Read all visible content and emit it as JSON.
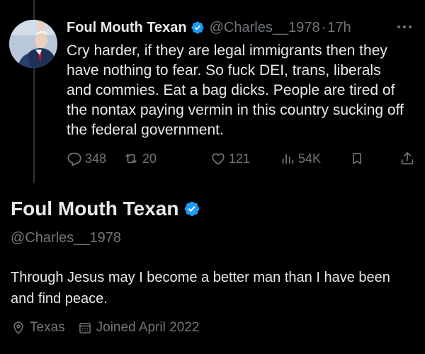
{
  "colors": {
    "background": "#000000",
    "primary_text": "#e7e9ea",
    "secondary_text": "#71767b",
    "verified_badge": "#1d9bf0",
    "thread_line": "#333639"
  },
  "tweet": {
    "author": {
      "display_name": "Foul Mouth Texan",
      "handle": "@Charles__1978",
      "verified": true,
      "avatar_icon": "profile-photo"
    },
    "separator": "·",
    "timestamp": "17h",
    "text": "Cry harder, if they are legal immigrants then they have nothing to fear. So fuck DEI, trans, liberals and commies. Eat a bag dicks. People are tired of the nontax paying vermin in this country sucking off the federal government.",
    "actions": {
      "replies": "348",
      "reposts": "20",
      "likes": "121",
      "views": "54K"
    }
  },
  "profile": {
    "display_name": "Foul Mouth Texan",
    "handle": "@Charles__1978",
    "verified": true,
    "bio": "Through Jesus may I become a better man than I have been and find peace.",
    "location": "Texas",
    "joined": "Joined April 2022"
  }
}
